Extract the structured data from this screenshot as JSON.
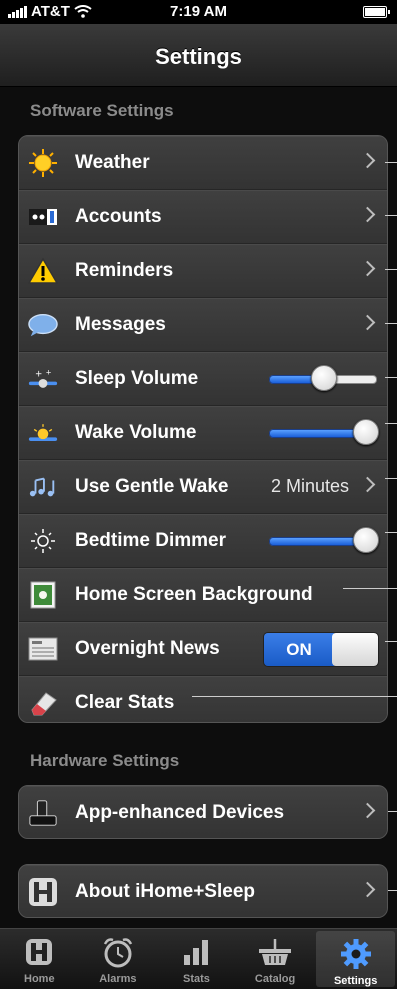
{
  "status_bar": {
    "carrier": "AT&T",
    "time": "7:19 AM"
  },
  "nav": {
    "title": "Settings"
  },
  "software": {
    "header": "Software Settings",
    "rows": [
      {
        "label": "Weather",
        "icon": "sun-icon"
      },
      {
        "label": "Accounts",
        "icon": "accounts-icon"
      },
      {
        "label": "Reminders",
        "icon": "warning-icon"
      },
      {
        "label": "Messages",
        "icon": "speech-bubble-icon"
      },
      {
        "label": "Sleep Volume",
        "icon": "sleep-volume-icon",
        "slider": 0.5
      },
      {
        "label": "Wake Volume",
        "icon": "wake-volume-icon",
        "slider": 1.0
      },
      {
        "label": "Use Gentle Wake",
        "value": "2 Minutes",
        "icon": "music-notes-icon"
      },
      {
        "label": "Bedtime Dimmer",
        "icon": "brightness-icon",
        "slider": 1.0
      },
      {
        "label": "Home Screen Background",
        "icon": "picture-icon"
      },
      {
        "label": "Overnight News",
        "toggle": "ON",
        "icon": "newspaper-icon"
      },
      {
        "label": "Clear Stats",
        "icon": "eraser-icon"
      }
    ]
  },
  "hardware": {
    "header": "Hardware Settings",
    "rows": [
      {
        "label": "App-enhanced Devices",
        "icon": "dock-icon"
      }
    ]
  },
  "about": {
    "label": "About iHome+Sleep",
    "icon": "ihome-icon"
  },
  "tabs": [
    {
      "label": "Home",
      "icon": "home-icon",
      "active": false
    },
    {
      "label": "Alarms",
      "icon": "clock-icon",
      "active": false
    },
    {
      "label": "Stats",
      "icon": "bar-chart-icon",
      "active": false
    },
    {
      "label": "Catalog",
      "icon": "basket-icon",
      "active": false
    },
    {
      "label": "Settings",
      "icon": "gear-icon",
      "active": true
    }
  ],
  "colors": {
    "accent": "#1b5fd9",
    "background": "#0d0d0d",
    "cell": "#3a3a3a"
  }
}
